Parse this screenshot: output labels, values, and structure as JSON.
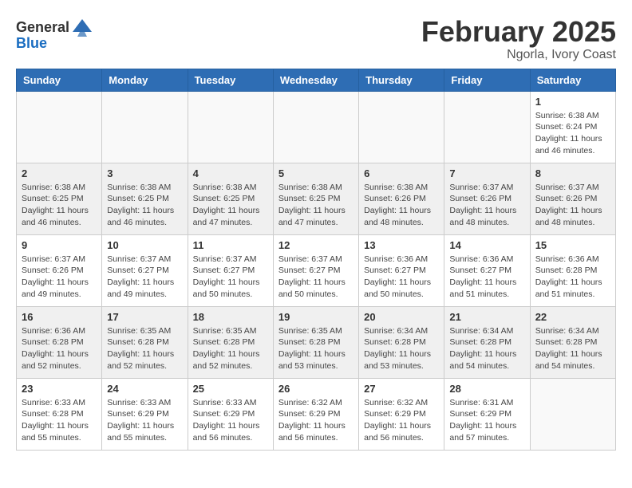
{
  "header": {
    "logo_general": "General",
    "logo_blue": "Blue",
    "month_title": "February 2025",
    "location": "Ngorla, Ivory Coast"
  },
  "days_of_week": [
    "Sunday",
    "Monday",
    "Tuesday",
    "Wednesday",
    "Thursday",
    "Friday",
    "Saturday"
  ],
  "weeks": [
    [
      {
        "day": "",
        "info": ""
      },
      {
        "day": "",
        "info": ""
      },
      {
        "day": "",
        "info": ""
      },
      {
        "day": "",
        "info": ""
      },
      {
        "day": "",
        "info": ""
      },
      {
        "day": "",
        "info": ""
      },
      {
        "day": "1",
        "info": "Sunrise: 6:38 AM\nSunset: 6:24 PM\nDaylight: 11 hours\nand 46 minutes."
      }
    ],
    [
      {
        "day": "2",
        "info": "Sunrise: 6:38 AM\nSunset: 6:25 PM\nDaylight: 11 hours\nand 46 minutes."
      },
      {
        "day": "3",
        "info": "Sunrise: 6:38 AM\nSunset: 6:25 PM\nDaylight: 11 hours\nand 46 minutes."
      },
      {
        "day": "4",
        "info": "Sunrise: 6:38 AM\nSunset: 6:25 PM\nDaylight: 11 hours\nand 47 minutes."
      },
      {
        "day": "5",
        "info": "Sunrise: 6:38 AM\nSunset: 6:25 PM\nDaylight: 11 hours\nand 47 minutes."
      },
      {
        "day": "6",
        "info": "Sunrise: 6:38 AM\nSunset: 6:26 PM\nDaylight: 11 hours\nand 48 minutes."
      },
      {
        "day": "7",
        "info": "Sunrise: 6:37 AM\nSunset: 6:26 PM\nDaylight: 11 hours\nand 48 minutes."
      },
      {
        "day": "8",
        "info": "Sunrise: 6:37 AM\nSunset: 6:26 PM\nDaylight: 11 hours\nand 48 minutes."
      }
    ],
    [
      {
        "day": "9",
        "info": "Sunrise: 6:37 AM\nSunset: 6:26 PM\nDaylight: 11 hours\nand 49 minutes."
      },
      {
        "day": "10",
        "info": "Sunrise: 6:37 AM\nSunset: 6:27 PM\nDaylight: 11 hours\nand 49 minutes."
      },
      {
        "day": "11",
        "info": "Sunrise: 6:37 AM\nSunset: 6:27 PM\nDaylight: 11 hours\nand 50 minutes."
      },
      {
        "day": "12",
        "info": "Sunrise: 6:37 AM\nSunset: 6:27 PM\nDaylight: 11 hours\nand 50 minutes."
      },
      {
        "day": "13",
        "info": "Sunrise: 6:36 AM\nSunset: 6:27 PM\nDaylight: 11 hours\nand 50 minutes."
      },
      {
        "day": "14",
        "info": "Sunrise: 6:36 AM\nSunset: 6:27 PM\nDaylight: 11 hours\nand 51 minutes."
      },
      {
        "day": "15",
        "info": "Sunrise: 6:36 AM\nSunset: 6:28 PM\nDaylight: 11 hours\nand 51 minutes."
      }
    ],
    [
      {
        "day": "16",
        "info": "Sunrise: 6:36 AM\nSunset: 6:28 PM\nDaylight: 11 hours\nand 52 minutes."
      },
      {
        "day": "17",
        "info": "Sunrise: 6:35 AM\nSunset: 6:28 PM\nDaylight: 11 hours\nand 52 minutes."
      },
      {
        "day": "18",
        "info": "Sunrise: 6:35 AM\nSunset: 6:28 PM\nDaylight: 11 hours\nand 52 minutes."
      },
      {
        "day": "19",
        "info": "Sunrise: 6:35 AM\nSunset: 6:28 PM\nDaylight: 11 hours\nand 53 minutes."
      },
      {
        "day": "20",
        "info": "Sunrise: 6:34 AM\nSunset: 6:28 PM\nDaylight: 11 hours\nand 53 minutes."
      },
      {
        "day": "21",
        "info": "Sunrise: 6:34 AM\nSunset: 6:28 PM\nDaylight: 11 hours\nand 54 minutes."
      },
      {
        "day": "22",
        "info": "Sunrise: 6:34 AM\nSunset: 6:28 PM\nDaylight: 11 hours\nand 54 minutes."
      }
    ],
    [
      {
        "day": "23",
        "info": "Sunrise: 6:33 AM\nSunset: 6:28 PM\nDaylight: 11 hours\nand 55 minutes."
      },
      {
        "day": "24",
        "info": "Sunrise: 6:33 AM\nSunset: 6:29 PM\nDaylight: 11 hours\nand 55 minutes."
      },
      {
        "day": "25",
        "info": "Sunrise: 6:33 AM\nSunset: 6:29 PM\nDaylight: 11 hours\nand 56 minutes."
      },
      {
        "day": "26",
        "info": "Sunrise: 6:32 AM\nSunset: 6:29 PM\nDaylight: 11 hours\nand 56 minutes."
      },
      {
        "day": "27",
        "info": "Sunrise: 6:32 AM\nSunset: 6:29 PM\nDaylight: 11 hours\nand 56 minutes."
      },
      {
        "day": "28",
        "info": "Sunrise: 6:31 AM\nSunset: 6:29 PM\nDaylight: 11 hours\nand 57 minutes."
      },
      {
        "day": "",
        "info": ""
      }
    ]
  ]
}
